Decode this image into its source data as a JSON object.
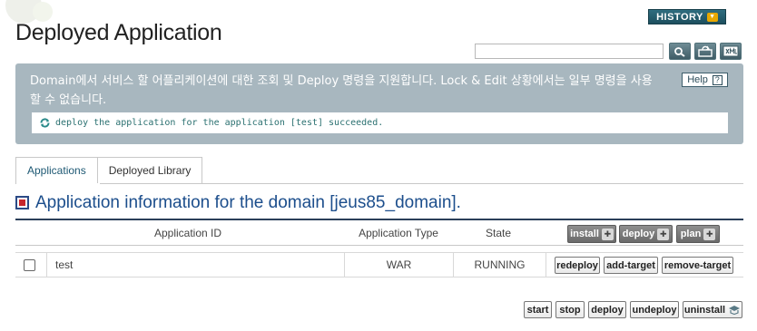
{
  "page": {
    "title": "Deployed Application"
  },
  "header": {
    "history_label": "HISTORY",
    "search": {
      "value": "",
      "placeholder": ""
    }
  },
  "info": {
    "description": "Domain에서 서비스 할 어플리케이션에 대한 조회 및 Deploy 명령을 지원합니다. Lock & Edit 상황에서는 일부 명령을 사용할 수 없습니다.",
    "help_label": "Help",
    "message": "deploy the application for the application [test] succeeded."
  },
  "tabs": [
    {
      "label": "Applications",
      "active": true
    },
    {
      "label": "Deployed Library",
      "active": false
    }
  ],
  "section": {
    "title": "Application information for the domain [jeus85_domain]."
  },
  "table": {
    "headers": {
      "id": "Application ID",
      "type": "Application Type",
      "state": "State"
    },
    "header_actions": [
      {
        "label": "install"
      },
      {
        "label": "deploy"
      },
      {
        "label": "plan"
      }
    ],
    "rows": [
      {
        "id": "test",
        "type": "WAR",
        "state": "RUNNING",
        "checked": false,
        "actions": [
          {
            "label": "redeploy"
          },
          {
            "label": "add-target"
          },
          {
            "label": "remove-target"
          }
        ]
      }
    ]
  },
  "footer_actions": [
    {
      "label": "start"
    },
    {
      "label": "stop"
    },
    {
      "label": "deploy"
    },
    {
      "label": "undeploy"
    },
    {
      "label": "uninstall"
    }
  ],
  "colors": {
    "info_background": "#a8b7bf",
    "title_blue": "#1c4e8c",
    "history_button": "#1d4f5e",
    "message_text": "#2a7070"
  },
  "icons": {
    "search": "search-icon",
    "refresh": "refresh-icon",
    "export": "xml-export-icon",
    "message": "refresh-success-icon",
    "section": "section-marker-icon"
  }
}
